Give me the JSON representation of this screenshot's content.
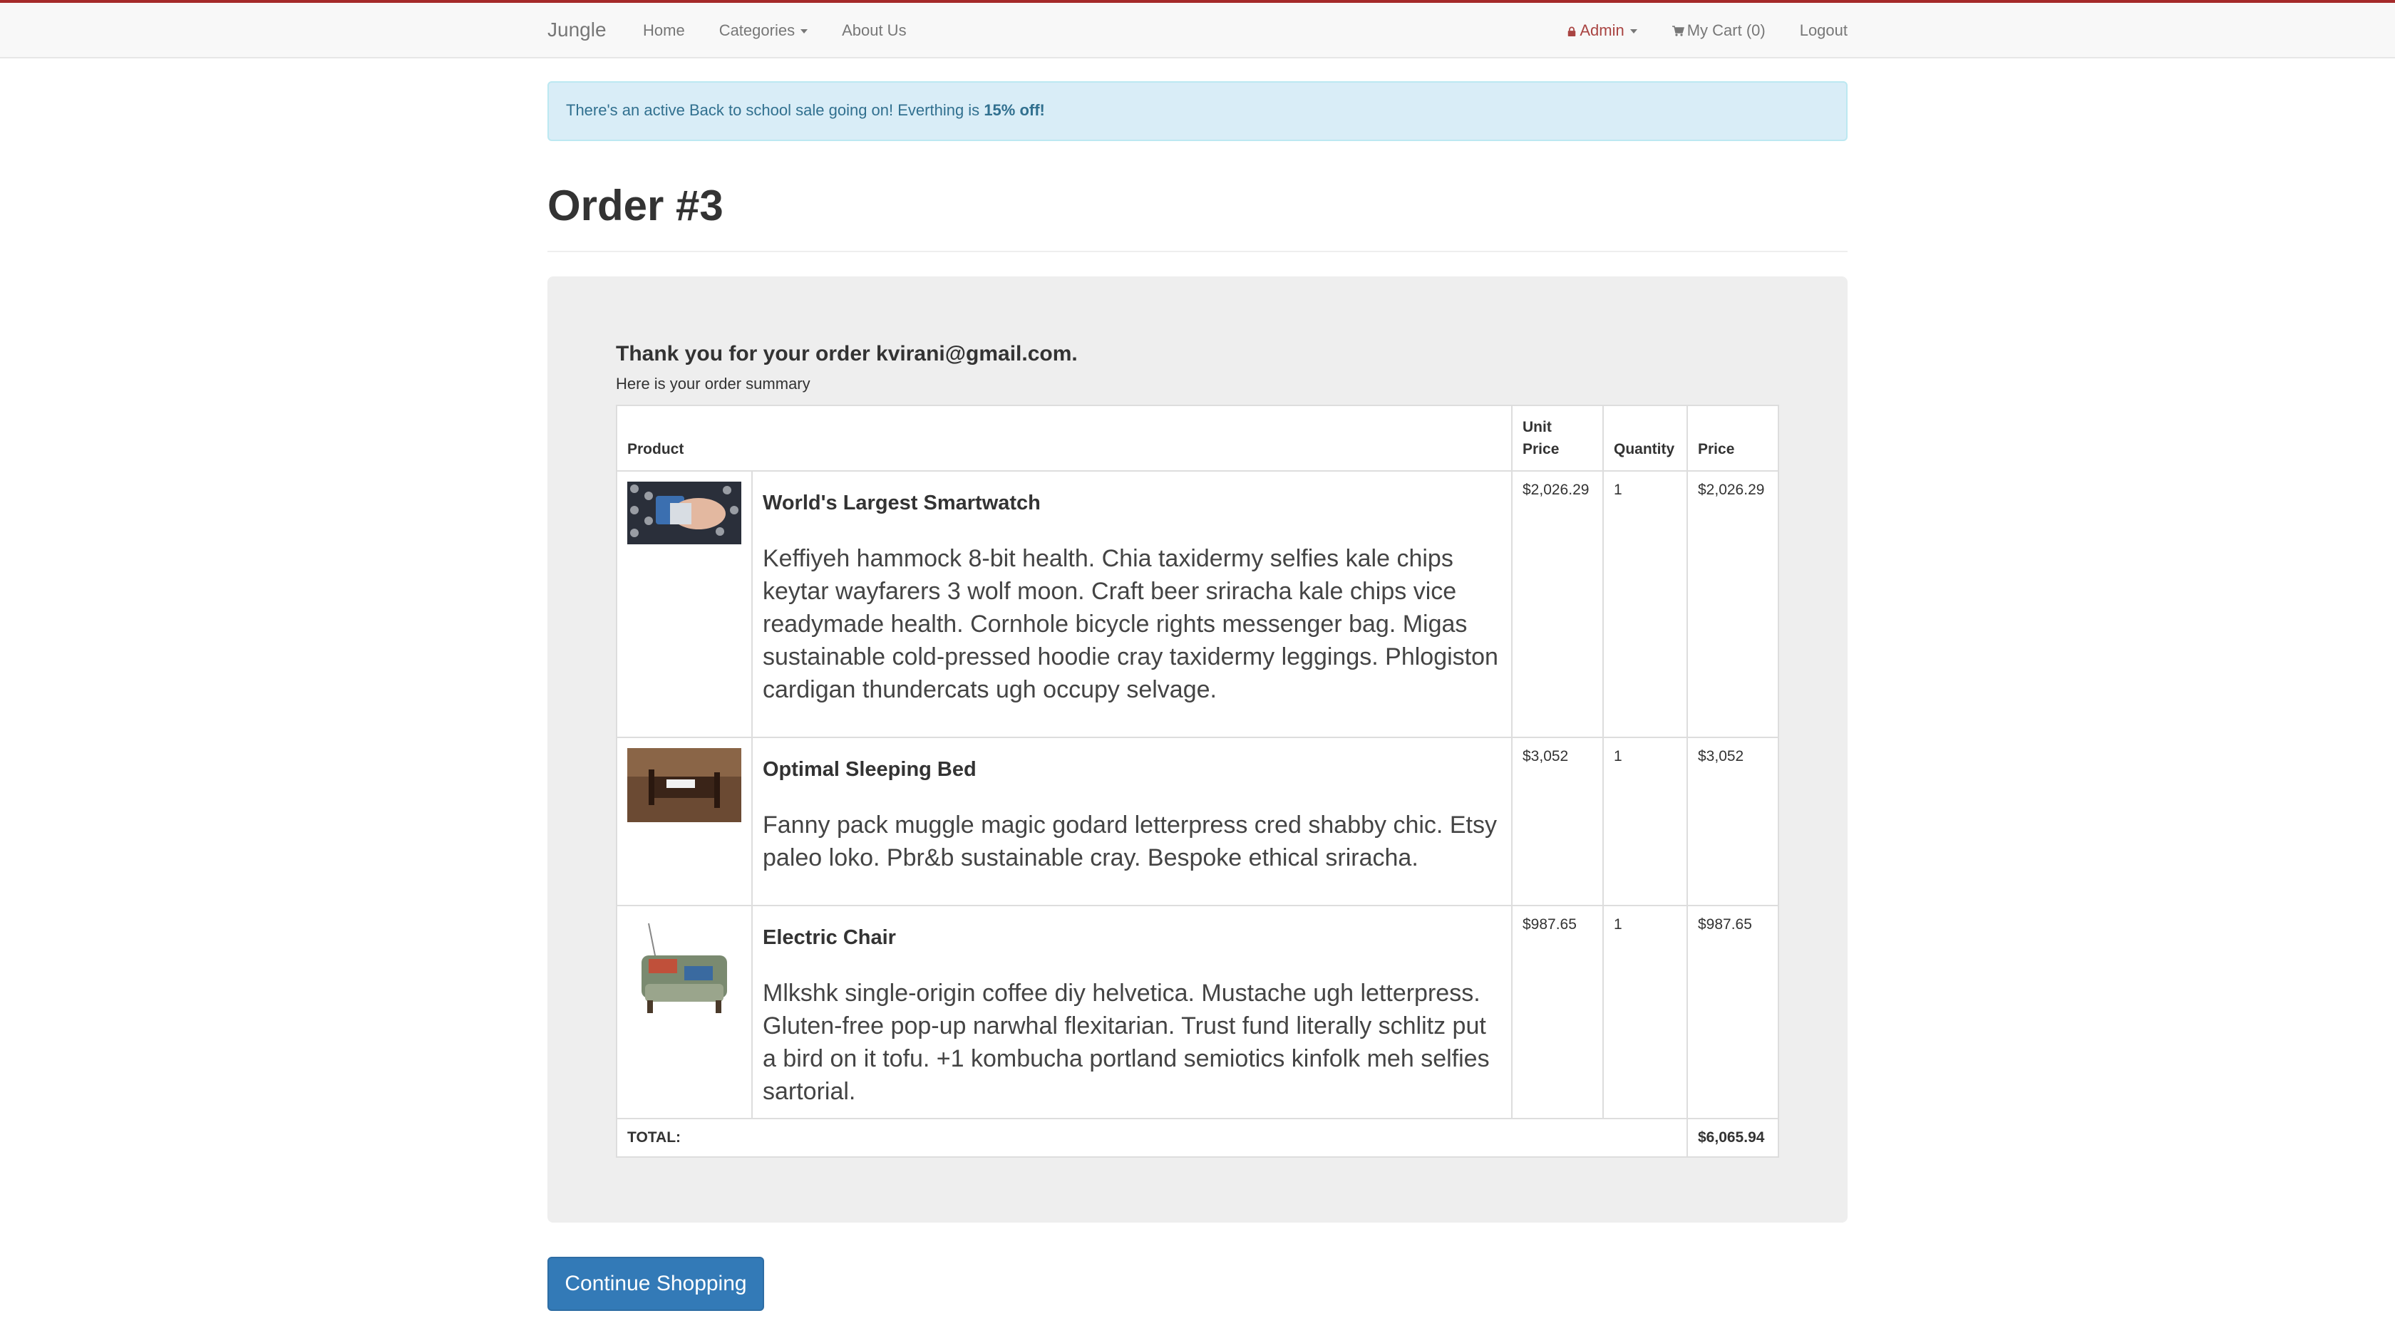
{
  "navbar": {
    "brand": "Jungle",
    "links": {
      "home": "Home",
      "categories": "Categories",
      "about": "About Us"
    },
    "right": {
      "admin": "Admin",
      "cart": "My Cart (0)",
      "logout": "Logout"
    }
  },
  "alert": {
    "text": "There's an active Back to school sale going on! Everthing is ",
    "highlight": "15% off!"
  },
  "page": {
    "title": "Order #3"
  },
  "order": {
    "thanks": "Thank you for your order kvirani@gmail.com.",
    "summary": "Here is your order summary",
    "headers": {
      "product": "Product",
      "unit_price_1": "Unit",
      "unit_price_2": "Price",
      "quantity": "Quantity",
      "price": "Price"
    },
    "items": [
      {
        "name": "World's Largest Smartwatch",
        "description": "Keffiyeh hammock 8-bit health. Chia taxidermy selfies kale chips keytar wayfarers 3 wolf moon. Craft beer sriracha kale chips vice readymade health. Cornhole bicycle rights messenger bag. Migas sustainable cold-pressed hoodie cray taxidermy leggings. Phlogiston cardigan thundercats ugh occupy selvage.",
        "unit_price": "$2,026.29",
        "quantity": "1",
        "price": "$2,026.29",
        "image_icon": "smartwatch-image"
      },
      {
        "name": "Optimal Sleeping Bed",
        "description": "Fanny pack muggle magic godard letterpress cred shabby chic. Etsy paleo loko. Pbr&b sustainable cray. Bespoke ethical sriracha.",
        "unit_price": "$3,052",
        "quantity": "1",
        "price": "$3,052",
        "image_icon": "bed-image"
      },
      {
        "name": "Electric Chair",
        "description": "Mlkshk single-origin coffee diy helvetica. Mustache ugh letterpress. Gluten-free pop-up narwhal flexitarian. Trust fund literally schlitz put a bird on it tofu. +1 kombucha portland semiotics kinfolk meh selfies sartorial.",
        "unit_price": "$987.65",
        "quantity": "1",
        "price": "$987.65",
        "image_icon": "chair-image"
      }
    ],
    "total_label": "TOTAL:",
    "total_value": "$6,065.94"
  },
  "actions": {
    "continue": "Continue Shopping"
  },
  "colors": {
    "accent": "#337ab7",
    "alert_bg": "#d9edf7",
    "admin": "#a94442",
    "top_line": "#a52a2a"
  }
}
